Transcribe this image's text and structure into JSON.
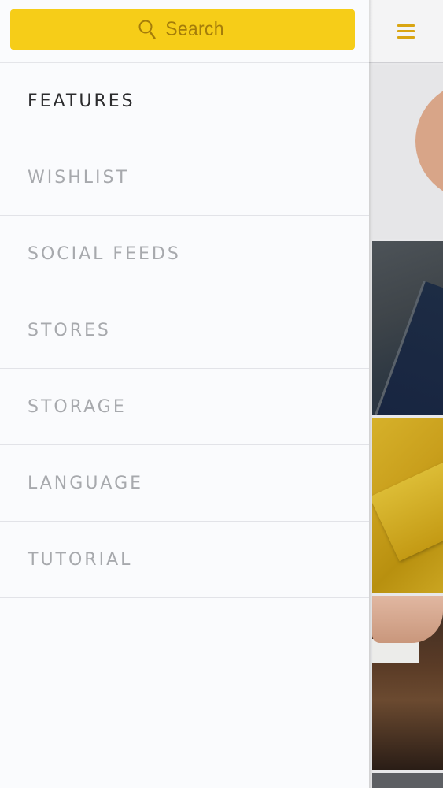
{
  "search": {
    "placeholder": "Search",
    "icon": "search-icon"
  },
  "menu": {
    "active_index": 0,
    "items": [
      {
        "label": "FEATURES",
        "active": true
      },
      {
        "label": "WISHLIST",
        "active": false
      },
      {
        "label": "SOCIAL FEEDS",
        "active": false
      },
      {
        "label": "STORES",
        "active": false
      },
      {
        "label": "STORAGE",
        "active": false
      },
      {
        "label": "LANGUAGE",
        "active": false
      },
      {
        "label": "TUTORIAL",
        "active": false
      }
    ]
  },
  "app_header": {
    "menu_icon": "hamburger-menu-icon"
  },
  "colors": {
    "accent_yellow": "#f6cd18",
    "search_text": "#a57d0a",
    "hamburger": "#d9a512",
    "menu_active": "#2b2b2d",
    "menu_inactive": "#a7a9ad",
    "drawer_bg": "#fafbfd"
  }
}
